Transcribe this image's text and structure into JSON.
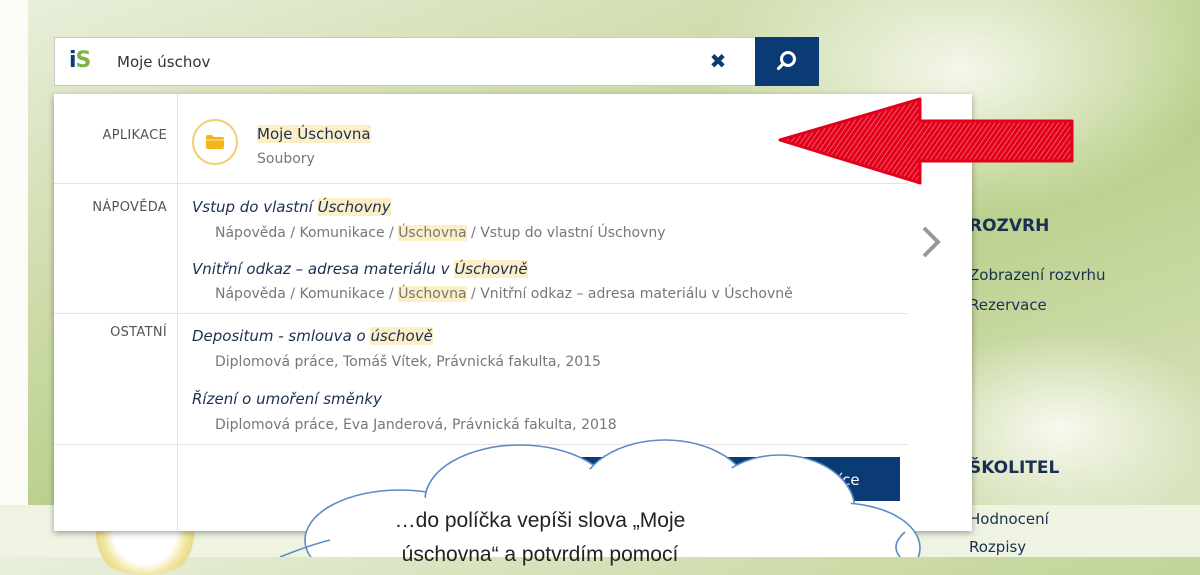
{
  "search": {
    "logo_i": "i",
    "logo_s": "S",
    "value": "Moje úschov",
    "clear_icon": "close-icon",
    "search_icon": "search-icon"
  },
  "categories": {
    "apps": "APLIKACE",
    "help": "NÁPOVĚDA",
    "other": "OSTATNÍ"
  },
  "app_result": {
    "title": "Moje Úschovna",
    "subtitle": "Soubory",
    "icon": "folder-icon"
  },
  "help_results": [
    {
      "title_pre": "Vstup do vlastní ",
      "title_hl": "Úschovny",
      "path_pre": "Nápověda / Komunikace / ",
      "path_hl": "Úschovna",
      "path_post": " / Vstup do vlastní Úschovny"
    },
    {
      "title_pre": "Vnitřní odkaz – adresa materiálu v ",
      "title_hl": "Úschovně",
      "path_pre": "Nápověda / Komunikace / ",
      "path_hl": "Úschovna",
      "path_post": " / Vnitřní odkaz – adresa materiálu v Úschovně"
    }
  ],
  "other_results": [
    {
      "title_pre": "Depositum - smlouva o ",
      "title_hl": "úschově",
      "sub": "Diplomová práce, Tomáš Vítek, Právnická fakulta, 2015"
    },
    {
      "title": "Řízení o umoření směnky",
      "sub": "Diplomová práce, Eva Janderová, Právnická fakulta, 2018"
    }
  ],
  "more_button_label": "íce",
  "sidebar": {
    "rozvrh": {
      "heading": "ROZVRH",
      "links": [
        "Zobrazení rozvrhu",
        "Rezervace"
      ]
    },
    "skolitel": {
      "heading": "ŠKOLITEL",
      "links": [
        "Hodnocení",
        "Rozpisy"
      ]
    }
  },
  "callout": {
    "line1": "…do políčka vepíši slova „Moje",
    "line2": "úschovna“ a potvrdím pomocí"
  },
  "colors": {
    "brand_blue": "#0a3b75",
    "highlight": "#fcefc8",
    "arrow_red": "#e3001b"
  }
}
